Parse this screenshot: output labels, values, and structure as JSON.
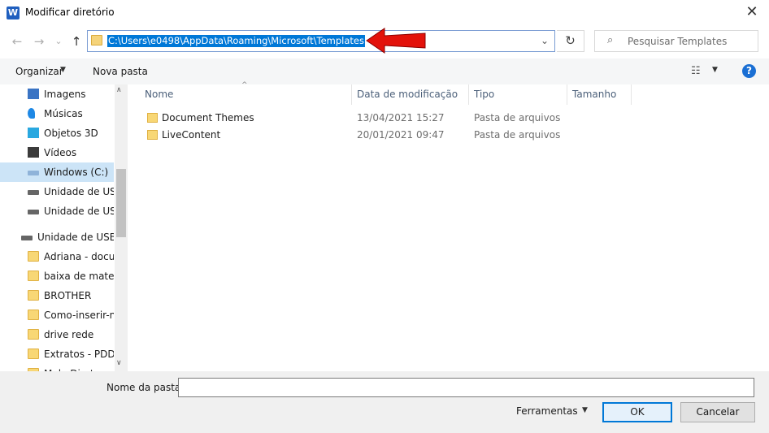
{
  "window": {
    "app_icon": "W",
    "title": "Modificar diretório",
    "close": "✕"
  },
  "nav": {
    "back": "←",
    "forward": "→",
    "recent": "⌄",
    "up": "↑",
    "address": "C:\\Users\\e0498\\AppData\\Roaming\\Microsoft\\Templates",
    "dropdown": "⌄",
    "refresh": "↻",
    "search_placeholder": "Pesquisar Templates",
    "search_icon": "⌕"
  },
  "annotation_arrow_color": "#e3120b",
  "toolbar": {
    "organize": "Organizar",
    "new_folder": "Nova pasta",
    "caret": "▼",
    "view_icon": "☷",
    "help": "?"
  },
  "sidebar": {
    "items": [
      {
        "label": "Imagens",
        "icon": "images-icon"
      },
      {
        "label": "Músicas",
        "icon": "music-icon"
      },
      {
        "label": "Objetos 3D",
        "icon": "cube-3d-icon"
      },
      {
        "label": "Vídeos",
        "icon": "video-icon"
      },
      {
        "label": "Windows (C:)",
        "icon": "windows-drive-icon"
      },
      {
        "label": "Unidade de USB",
        "icon": "usb-drive-icon"
      },
      {
        "label": "Unidade de USB",
        "icon": "usb-drive-icon"
      },
      {
        "label": "Unidade de USB (I",
        "icon": "usb-drive-icon"
      },
      {
        "label": "Adriana - docun",
        "icon": "folder-icon"
      },
      {
        "label": "baixa de materia",
        "icon": "folder-icon"
      },
      {
        "label": "BROTHER",
        "icon": "folder-icon"
      },
      {
        "label": "Como-inserir-nc",
        "icon": "folder-icon"
      },
      {
        "label": "drive rede",
        "icon": "folder-icon"
      },
      {
        "label": "Extratos - PDDE",
        "icon": "folder-icon"
      },
      {
        "label": "Mala Direta",
        "icon": "folder-icon"
      }
    ],
    "selected": "Windows (C:)",
    "scroll_up": "∧",
    "scroll_down": "∨"
  },
  "columns": {
    "name": "Nome",
    "date": "Data de modificação",
    "type": "Tipo",
    "size": "Tamanho",
    "sort_caret": "^"
  },
  "files": [
    {
      "name": "Document Themes",
      "date": "13/04/2021 15:27",
      "type": "Pasta de arquivos"
    },
    {
      "name": "LiveContent",
      "date": "20/01/2021 09:47",
      "type": "Pasta de arquivos"
    }
  ],
  "footer": {
    "folder_label": "Nome da pasta:",
    "folder_value": "",
    "tools": "Ferramentas",
    "tools_caret": "▼",
    "ok": "OK",
    "cancel": "Cancelar"
  }
}
